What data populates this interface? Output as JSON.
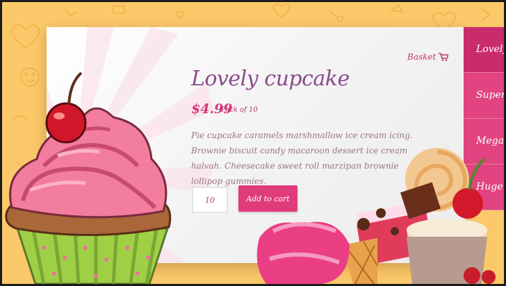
{
  "header": {
    "basket_label": "Basket",
    "basket_icon": "cart-icon"
  },
  "product": {
    "title": "Lovely cupcake",
    "price": "$4.99",
    "pack": "Pack of 10",
    "description": "Pie cupcake caramels marshmallow ice cream icing. Brownie biscuit candy macaroon dessert ice cream halvah. Cheesecake sweet roll marzipan brownie lollipop gummies.",
    "quantity": "10",
    "add_to_cart_label": "Add to cart"
  },
  "sidebar": {
    "items": [
      {
        "label": "Lovely c"
      },
      {
        "label": "Super c"
      },
      {
        "label": "Mega c"
      },
      {
        "label": "Huge c"
      }
    ]
  },
  "colors": {
    "accent": "#e03c7c",
    "title": "#8a4a8c",
    "background": "#fbc96a"
  }
}
